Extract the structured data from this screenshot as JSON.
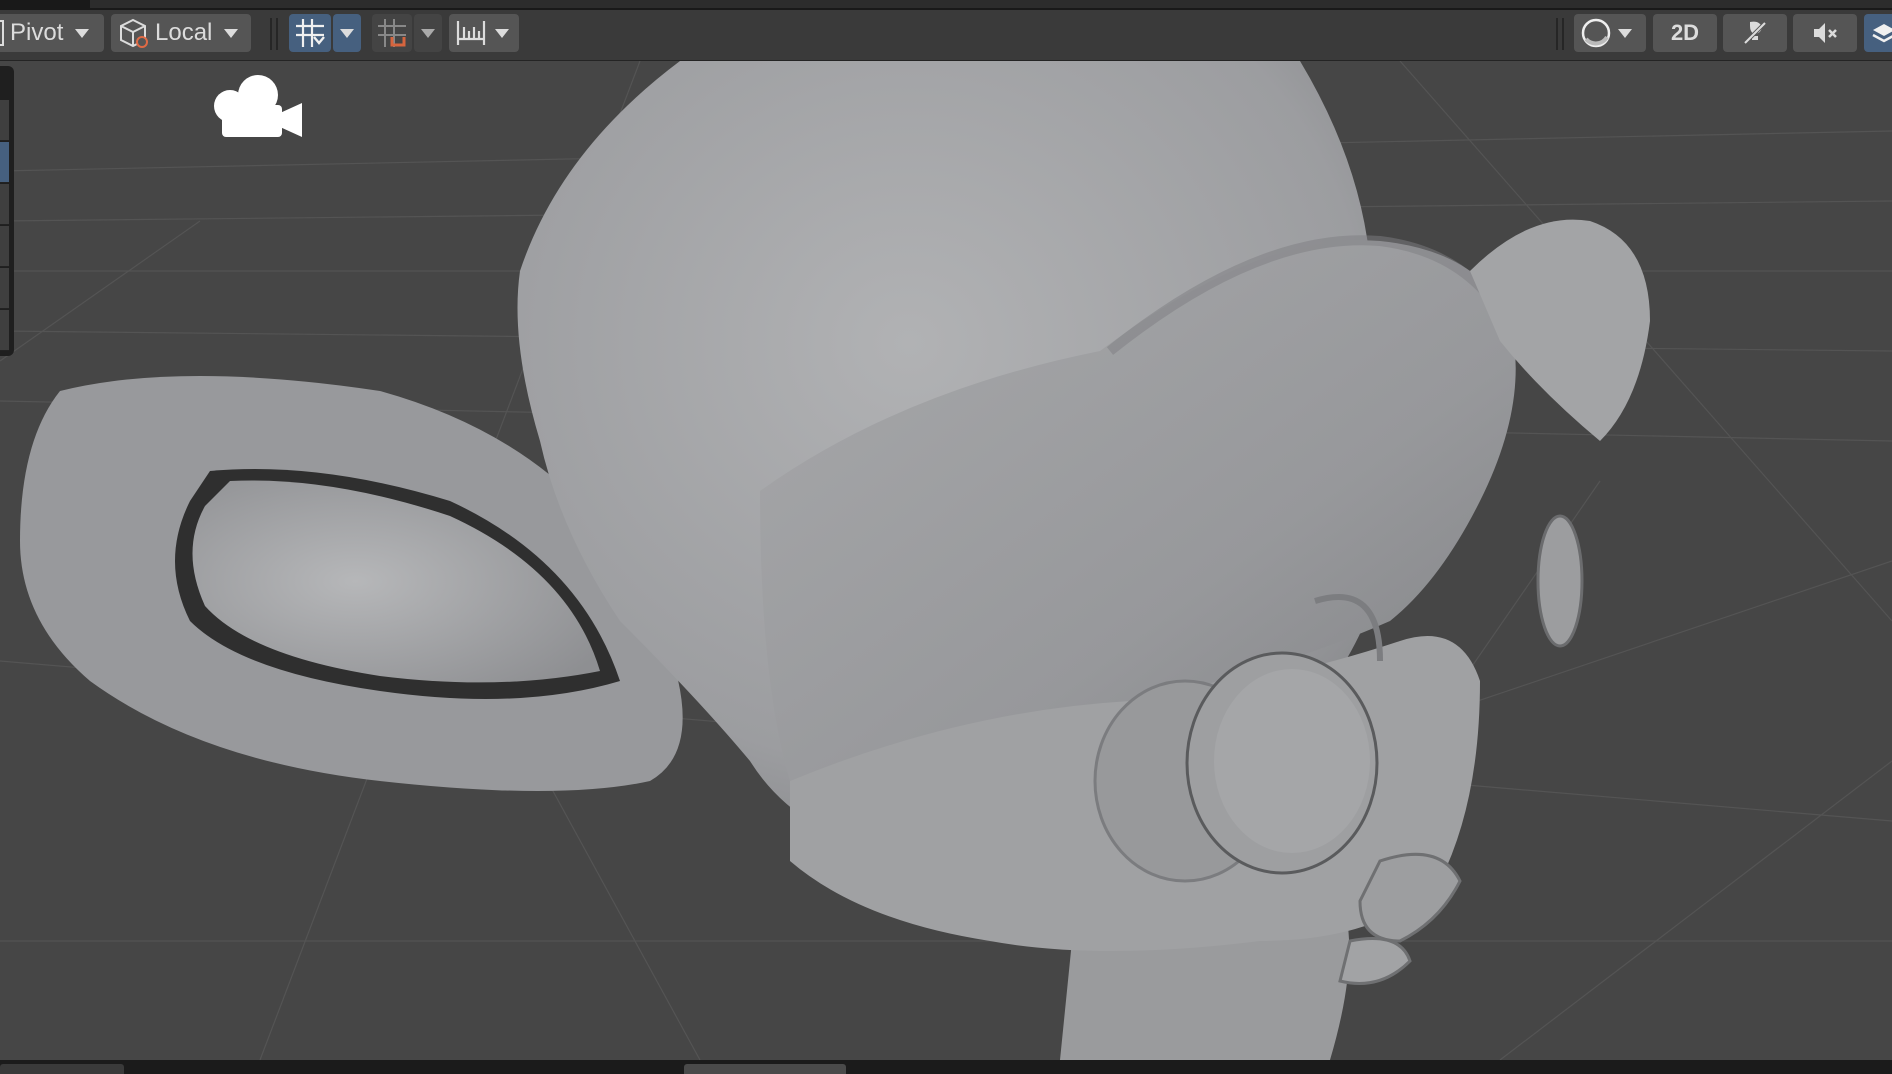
{
  "toolbar": {
    "pivot_label": "Pivot",
    "local_label": "Local",
    "two_d_label": "2D",
    "grid_snap_active": true
  },
  "icons": {
    "handle_position": "cube-icon",
    "grid_snap": "grid-snap-icon",
    "increment_snap": "increment-snap-icon",
    "ruler": "ruler-icon",
    "draw_mode": "sphere-shading-icon",
    "lighting": "lighting-icon",
    "audio": "audio-mute-icon",
    "effects": "layers-icon",
    "scene_camera": "video-camera-icon"
  },
  "colors": {
    "toolbar_bg": "#3a3a3a",
    "button_bg": "#555555",
    "active_blue": "#46607f",
    "viewport_bg": "#464646",
    "mesh_gray": "#9e9fa1"
  },
  "viewport": {
    "grid_visible": true,
    "object": "monkey-head-mesh"
  }
}
